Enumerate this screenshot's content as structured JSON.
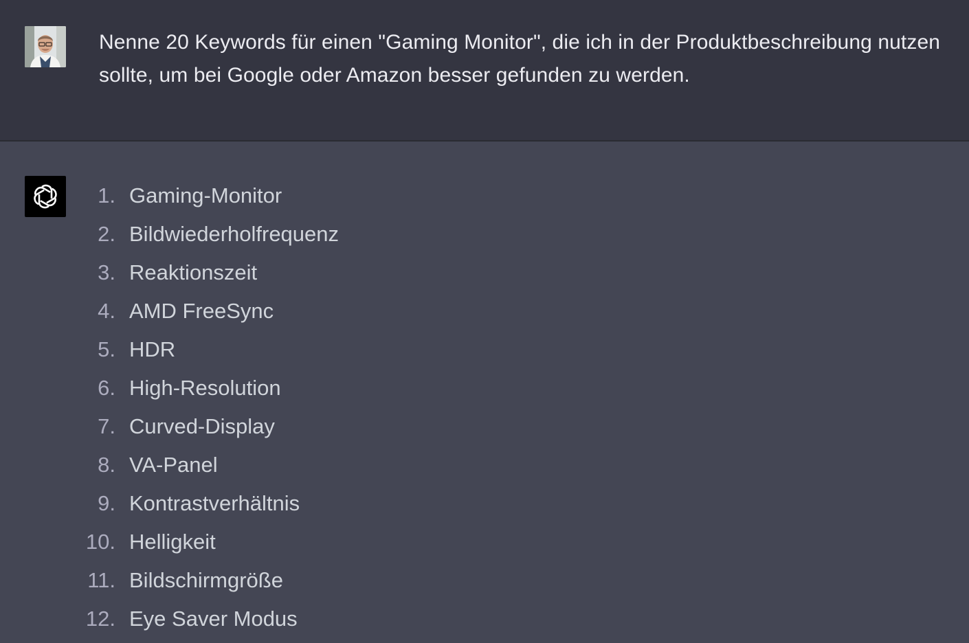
{
  "user_message": {
    "text": "Nenne 20 Keywords für einen \"Gaming Monitor\", die ich in der Produktbeschreibung nutzen sollte, um bei Google oder Amazon besser gefunden zu werden."
  },
  "assistant_message": {
    "avatar_icon": "openai-logo-icon",
    "items": [
      {
        "num": "1.",
        "text": "Gaming-Monitor"
      },
      {
        "num": "2.",
        "text": "Bildwiederholfrequenz"
      },
      {
        "num": "3.",
        "text": "Reaktionszeit"
      },
      {
        "num": "4.",
        "text": "AMD FreeSync"
      },
      {
        "num": "5.",
        "text": "HDR"
      },
      {
        "num": "6.",
        "text": "High-Resolution"
      },
      {
        "num": "7.",
        "text": "Curved-Display"
      },
      {
        "num": "8.",
        "text": "VA-Panel"
      },
      {
        "num": "9.",
        "text": "Kontrastverhältnis"
      },
      {
        "num": "10.",
        "text": "Helligkeit"
      },
      {
        "num": "11.",
        "text": "Bildschirmgröße"
      },
      {
        "num": "12.",
        "text": "Eye Saver Modus"
      }
    ]
  },
  "colors": {
    "user_bg": "#343541",
    "assistant_bg": "#444654",
    "text": "#d1d5db",
    "number": "#acacbe"
  }
}
